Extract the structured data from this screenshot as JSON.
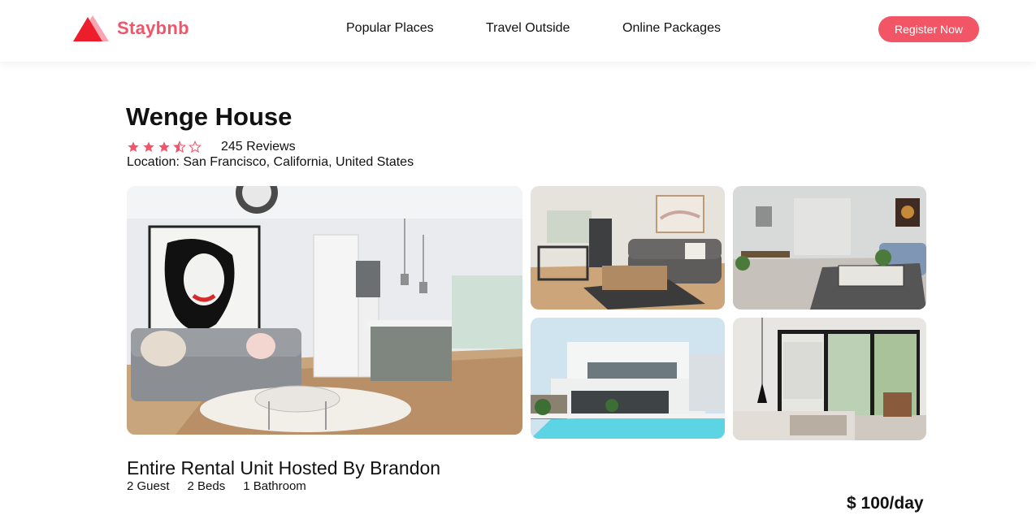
{
  "brand": {
    "name": "Staybnb",
    "accent_color": "#f25566",
    "logo_icon": "triangle-logo-icon"
  },
  "nav": {
    "items": [
      {
        "label": "Popular Places"
      },
      {
        "label": "Travel Outside"
      },
      {
        "label": "Online Packages"
      }
    ],
    "register_label": "Register Now"
  },
  "listing": {
    "title": "Wenge House",
    "rating": {
      "stars": 3.5,
      "max": 5,
      "icon": "star-icon"
    },
    "reviews_text": "245 Reviews",
    "location_text": "Location: San Francisco, California, United States",
    "photos": [
      {
        "subject": "living-room-kitchen"
      },
      {
        "subject": "living-room-dining"
      },
      {
        "subject": "living-room-lounge"
      },
      {
        "subject": "villa-pool-exterior"
      },
      {
        "subject": "bedroom-window"
      }
    ],
    "host_text": "Entire Rental Unit Hosted By Brandon",
    "specs": {
      "guests": "2 Guest",
      "beds": "2 Beds",
      "bathroom": "1 Bathroom"
    },
    "price_text": "$ 100/day"
  }
}
